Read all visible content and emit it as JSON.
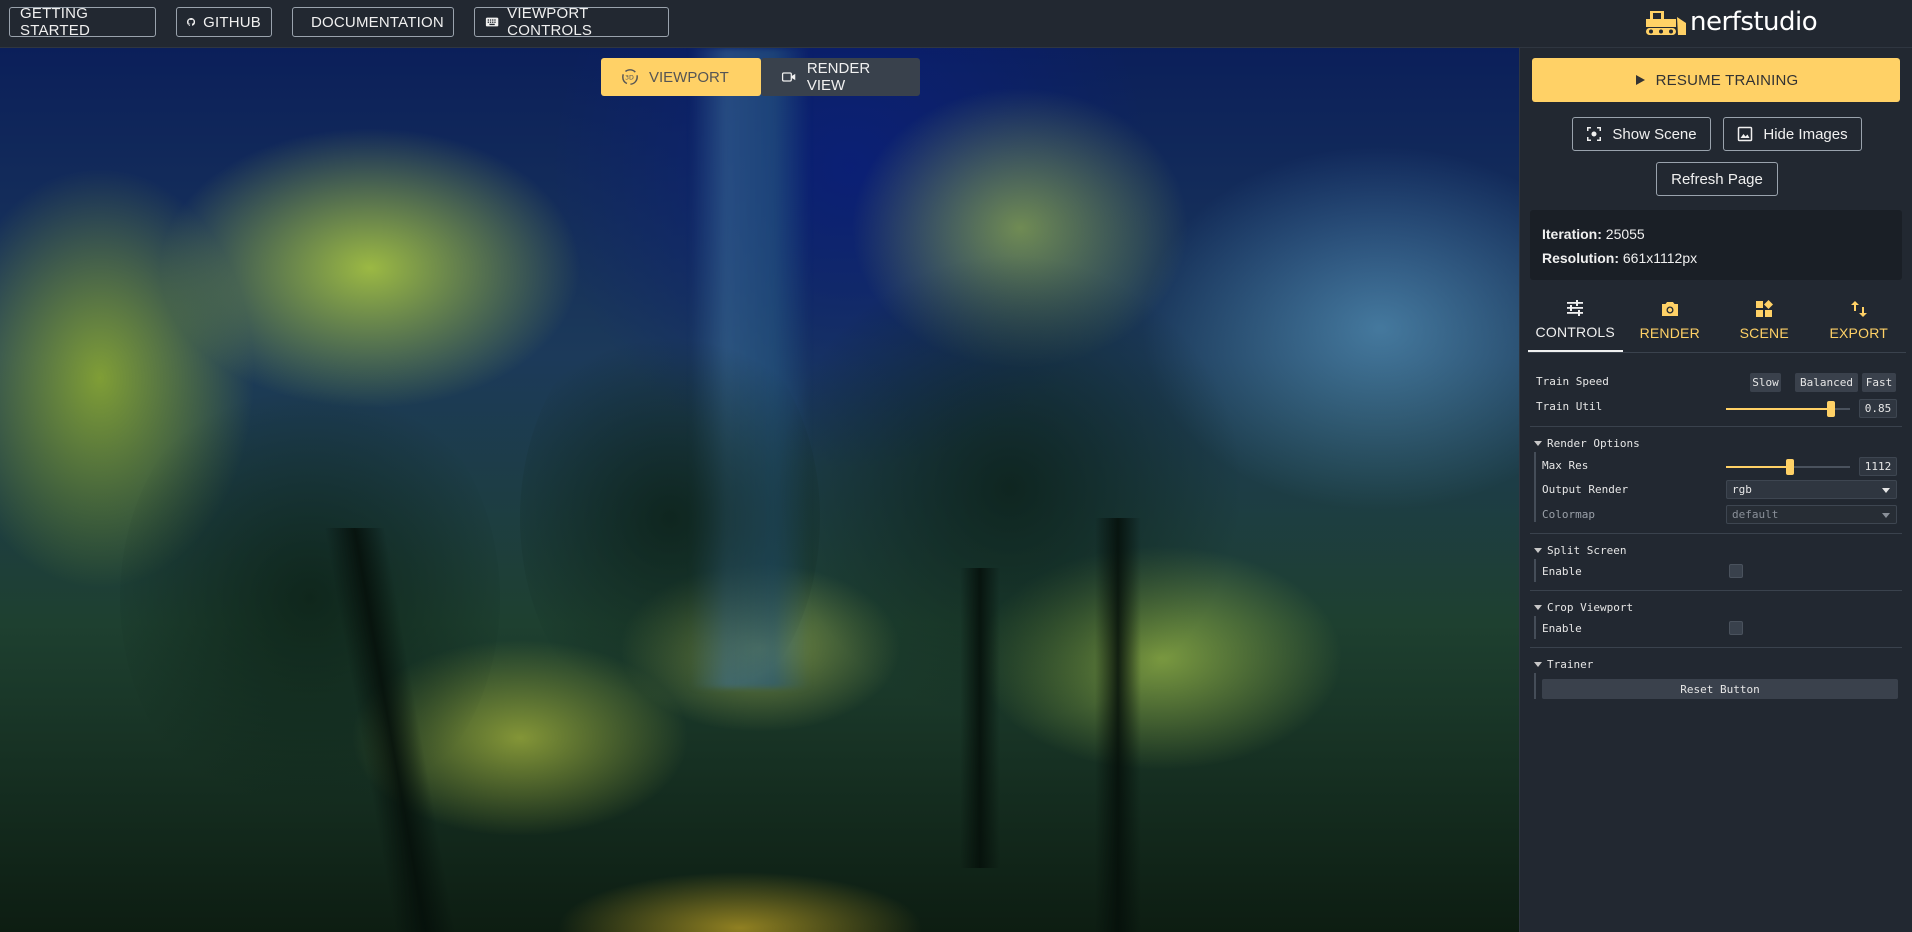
{
  "topbar": {
    "getting_started": "GETTING STARTED",
    "github": "GITHUB",
    "documentation": "DOCUMENTATION",
    "viewport_controls": "VIEWPORT CONTROLS",
    "logo_text": "nerfstudio"
  },
  "viewport_toggle": {
    "viewport": "VIEWPORT",
    "render_view": "RENDER VIEW",
    "active": "viewport"
  },
  "panel": {
    "resume_training": "RESUME TRAINING",
    "show_scene": "Show Scene",
    "hide_images": "Hide Images",
    "refresh_page": "Refresh Page",
    "stats": {
      "iteration_label": "Iteration:",
      "iteration_value": "25055",
      "resolution_label": "Resolution:",
      "resolution_value": "661x1112px"
    },
    "tabs": [
      {
        "label": "CONTROLS",
        "icon": "sliders-icon",
        "active": true
      },
      {
        "label": "RENDER",
        "icon": "camera-icon",
        "active": false
      },
      {
        "label": "SCENE",
        "icon": "widgets-icon",
        "active": false
      },
      {
        "label": "EXPORT",
        "icon": "import-export-icon",
        "active": false
      }
    ],
    "controls": {
      "train_speed_label": "Train Speed",
      "train_speed_options": [
        "Slow",
        "Balanced",
        "Fast"
      ],
      "train_util_label": "Train Util",
      "train_util_value": "0.85",
      "train_util_fraction": 0.85,
      "render_options": {
        "title": "Render Options",
        "max_res_label": "Max Res",
        "max_res_value": "1112",
        "max_res_fraction": 0.52,
        "output_render_label": "Output Render",
        "output_render_value": "rgb",
        "colormap_label": "Colormap",
        "colormap_value": "default"
      },
      "split_screen": {
        "title": "Split Screen",
        "enable_label": "Enable"
      },
      "crop_viewport": {
        "title": "Crop Viewport",
        "enable_label": "Enable"
      },
      "trainer": {
        "title": "Trainer",
        "reset_button": "Reset Button"
      }
    }
  },
  "colors": {
    "accent": "#ffd166",
    "background": "#222831"
  }
}
